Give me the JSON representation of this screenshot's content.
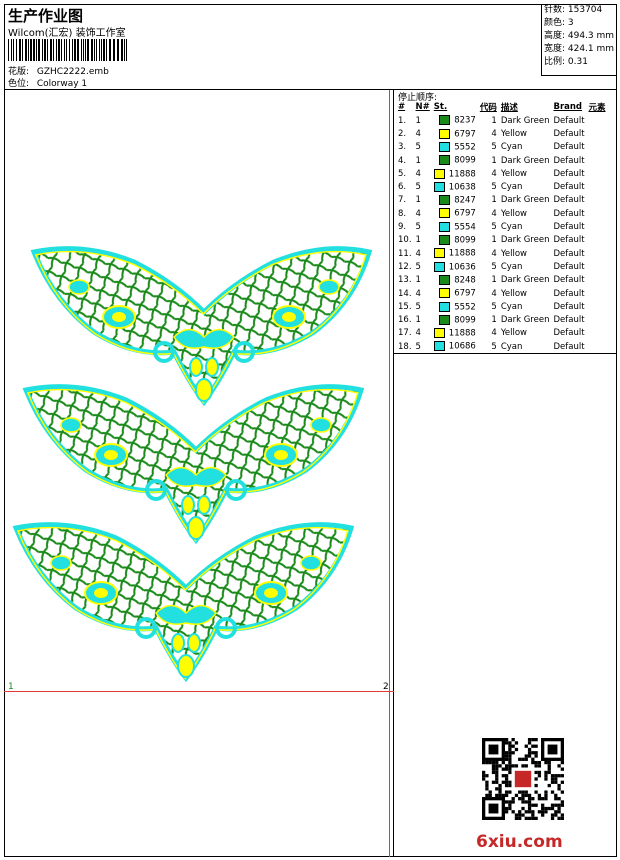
{
  "header": {
    "title": "生产作业图",
    "company": "Wilcom(汇宏) 装饰工作室",
    "design_label": "花版:",
    "design_value": "GZHC2222.emb",
    "colorway_label": "色位:",
    "colorway_value": "Colorway 1"
  },
  "stats": {
    "stitches": "针数: 153704",
    "colors": "颜色: 3",
    "height": "高度: 494.3 mm",
    "width": "宽度: 424.1 mm",
    "scale": "比例: 0.31"
  },
  "stop_sequence": {
    "title": "停止顺序:",
    "headers": [
      "#",
      "N#",
      "St.",
      "代码",
      "描述",
      "Brand",
      "元素"
    ],
    "rows": [
      {
        "n": "1.",
        "needle": "1",
        "color": "#1a8a1a",
        "st": "8237",
        "code": "1",
        "desc": "Dark Green",
        "brand": "Default"
      },
      {
        "n": "2.",
        "needle": "4",
        "color": "#ffff00",
        "st": "6797",
        "code": "4",
        "desc": "Yellow",
        "brand": "Default"
      },
      {
        "n": "3.",
        "needle": "5",
        "color": "#22e0e0",
        "st": "5552",
        "code": "5",
        "desc": "Cyan",
        "brand": "Default"
      },
      {
        "n": "4.",
        "needle": "1",
        "color": "#1a8a1a",
        "st": "8099",
        "code": "1",
        "desc": "Dark Green",
        "brand": "Default"
      },
      {
        "n": "5.",
        "needle": "4",
        "color": "#ffff00",
        "st": "11888",
        "code": "4",
        "desc": "Yellow",
        "brand": "Default"
      },
      {
        "n": "6.",
        "needle": "5",
        "color": "#22e0e0",
        "st": "10638",
        "code": "5",
        "desc": "Cyan",
        "brand": "Default"
      },
      {
        "n": "7.",
        "needle": "1",
        "color": "#1a8a1a",
        "st": "8247",
        "code": "1",
        "desc": "Dark Green",
        "brand": "Default"
      },
      {
        "n": "8.",
        "needle": "4",
        "color": "#ffff00",
        "st": "6797",
        "code": "4",
        "desc": "Yellow",
        "brand": "Default"
      },
      {
        "n": "9.",
        "needle": "5",
        "color": "#22e0e0",
        "st": "5554",
        "code": "5",
        "desc": "Cyan",
        "brand": "Default"
      },
      {
        "n": "10.",
        "needle": "1",
        "color": "#1a8a1a",
        "st": "8099",
        "code": "1",
        "desc": "Dark Green",
        "brand": "Default"
      },
      {
        "n": "11.",
        "needle": "4",
        "color": "#ffff00",
        "st": "11888",
        "code": "4",
        "desc": "Yellow",
        "brand": "Default"
      },
      {
        "n": "12.",
        "needle": "5",
        "color": "#22e0e0",
        "st": "10636",
        "code": "5",
        "desc": "Cyan",
        "brand": "Default"
      },
      {
        "n": "13.",
        "needle": "1",
        "color": "#1a8a1a",
        "st": "8248",
        "code": "1",
        "desc": "Dark Green",
        "brand": "Default"
      },
      {
        "n": "14.",
        "needle": "4",
        "color": "#ffff00",
        "st": "6797",
        "code": "4",
        "desc": "Yellow",
        "brand": "Default"
      },
      {
        "n": "15.",
        "needle": "5",
        "color": "#22e0e0",
        "st": "5552",
        "code": "5",
        "desc": "Cyan",
        "brand": "Default"
      },
      {
        "n": "16.",
        "needle": "1",
        "color": "#1a8a1a",
        "st": "8099",
        "code": "1",
        "desc": "Dark Green",
        "brand": "Default"
      },
      {
        "n": "17.",
        "needle": "4",
        "color": "#ffff00",
        "st": "11888",
        "code": "4",
        "desc": "Yellow",
        "brand": "Default"
      },
      {
        "n": "18.",
        "needle": "5",
        "color": "#22e0e0",
        "st": "10686",
        "code": "5",
        "desc": "Cyan",
        "brand": "Default"
      }
    ]
  },
  "canvas": {
    "label_left": "1",
    "label_right": "2",
    "thread_colors": {
      "green": "#1a8a1a",
      "yellow": "#ffff00",
      "cyan": "#22e0e0"
    }
  },
  "branding": {
    "site": "6xiu.com",
    "qr_icon": "qr-code-icon"
  }
}
